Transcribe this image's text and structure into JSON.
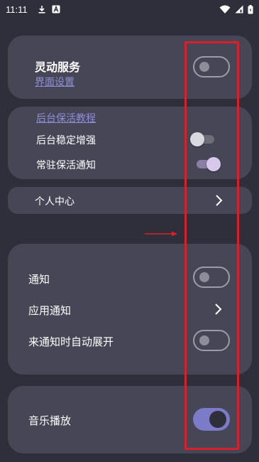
{
  "status_bar": {
    "time": "11:11",
    "icons": [
      "download-icon",
      "notification-a-icon",
      "wifi-icon",
      "signal-icon",
      "battery-icon"
    ]
  },
  "card1": {
    "title": "灵动服务",
    "link": "界面设置",
    "toggle_on": false
  },
  "card2": {
    "link": "后台保活教程",
    "items": [
      {
        "label": "后台稳定增强",
        "toggle_on": false
      },
      {
        "label": "常驻保活通知",
        "toggle_on": true
      }
    ]
  },
  "card3": {
    "label": "个人中心"
  },
  "card4": {
    "items": [
      {
        "label": "通知",
        "control": "toggle",
        "toggle_on": false
      },
      {
        "label": "应用通知",
        "control": "chevron"
      },
      {
        "label": "来通知时自动展开",
        "control": "toggle",
        "toggle_on": false
      }
    ]
  },
  "card5": {
    "label": "音乐播放",
    "toggle_on": true
  },
  "colors": {
    "background": "#2f2f3c",
    "card": "#464656",
    "link": "#8f8fd8",
    "toggle_on": "#7b7bc8",
    "annotation": "#d8202a"
  }
}
